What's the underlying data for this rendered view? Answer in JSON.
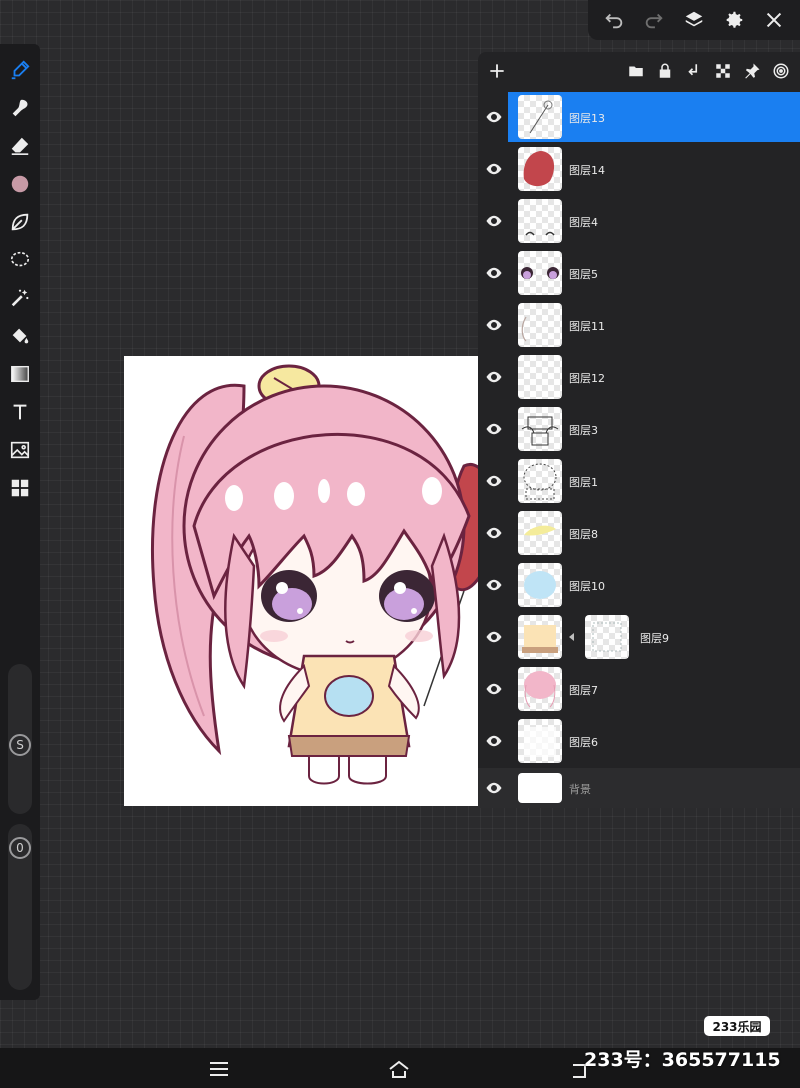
{
  "toolbar": {
    "icons": [
      "undo-icon",
      "redo-icon",
      "layers-icon",
      "settings-icon",
      "close-icon"
    ]
  },
  "left_tools": [
    "brush",
    "smudge",
    "eraser",
    "color",
    "leaf-brush",
    "lasso",
    "magic-wand",
    "fill-bucket",
    "gradient",
    "text",
    "image",
    "layout"
  ],
  "brush_color": "#c79aa6",
  "accent_color": "#1a7ff1",
  "sliders": {
    "size_label": "S",
    "opacity_label": "0"
  },
  "layers": {
    "items": [
      {
        "name": "图层13",
        "active": true
      },
      {
        "name": "图层14"
      },
      {
        "name": "图层4"
      },
      {
        "name": "图层5"
      },
      {
        "name": "图层11"
      },
      {
        "name": "图层12"
      },
      {
        "name": "图层3"
      },
      {
        "name": "图层1"
      },
      {
        "name": "图层8"
      },
      {
        "name": "图层10"
      },
      {
        "name": "图层9",
        "clipped": true
      },
      {
        "name": "图层7"
      },
      {
        "name": "图层6"
      }
    ],
    "background": "背景"
  },
  "watermark": {
    "logo": "233乐园",
    "id_text": "233号：365577115"
  }
}
